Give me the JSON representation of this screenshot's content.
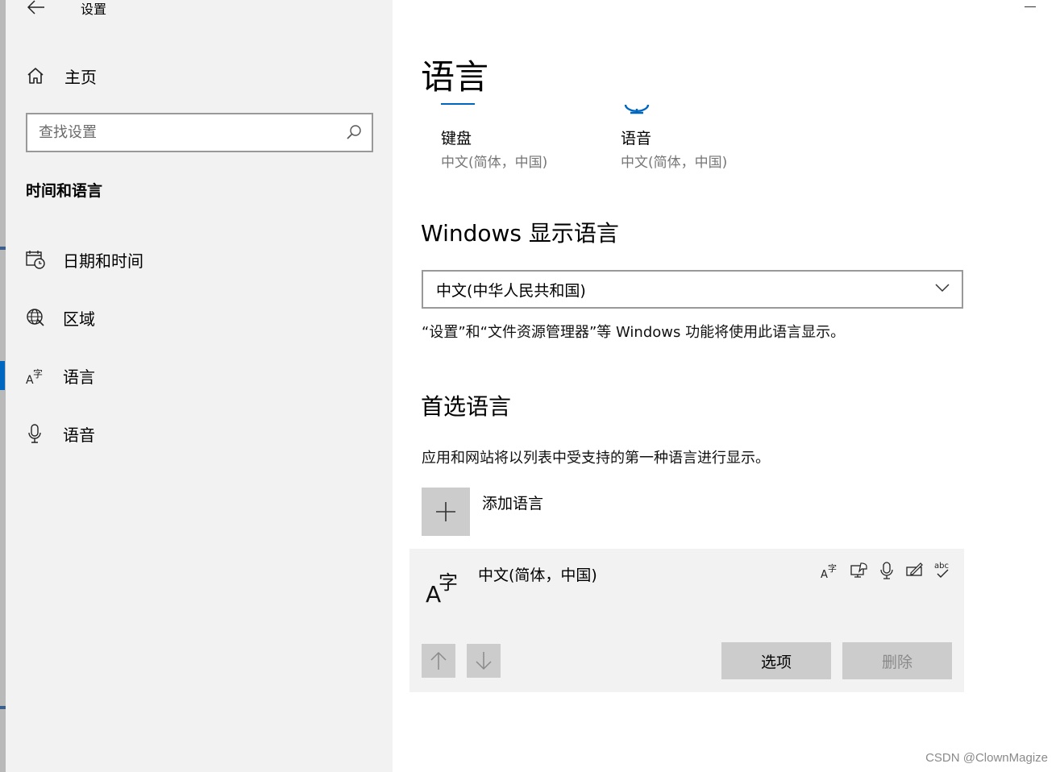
{
  "window": {
    "title": "设置"
  },
  "sidebar": {
    "home_label": "主页",
    "search_placeholder": "查找设置",
    "section_heading": "时间和语言",
    "items": [
      {
        "label": "日期和时间",
        "icon": "calendar-clock-icon",
        "active": false
      },
      {
        "label": "区域",
        "icon": "globe-region-icon",
        "active": false
      },
      {
        "label": "语言",
        "icon": "language-icon",
        "active": true
      },
      {
        "label": "语音",
        "icon": "microphone-icon",
        "active": false
      }
    ]
  },
  "main": {
    "title": "语言",
    "quick_tiles": [
      {
        "label": "键盘",
        "sub": "中文(简体，中国)",
        "icon": "keyboard-icon"
      },
      {
        "label": "语音",
        "sub": "中文(简体，中国)",
        "icon": "speech-icon"
      }
    ],
    "display_language": {
      "heading": "Windows 显示语言",
      "selected": "中文(中华人民共和国)",
      "description": "“设置”和“文件资源管理器”等 Windows 功能将使用此语言显示。"
    },
    "preferred": {
      "heading": "首选语言",
      "description": "应用和网站将以列表中受支持的第一种语言进行显示。",
      "add_label": "添加语言",
      "languages": [
        {
          "name": "中文(简体，中国)",
          "feature_icons": [
            "display-language-icon",
            "text-to-speech-icon",
            "speech-recognition-icon",
            "handwriting-icon",
            "spell-check-icon"
          ],
          "spell_check_text": "abc"
        }
      ],
      "options_label": "选项",
      "remove_label": "删除"
    }
  },
  "colors": {
    "accent": "#0067c0",
    "sidebar_bg": "#f2f2f2",
    "button_bg": "#cccccc"
  },
  "watermark": "CSDN @ClownMagize"
}
